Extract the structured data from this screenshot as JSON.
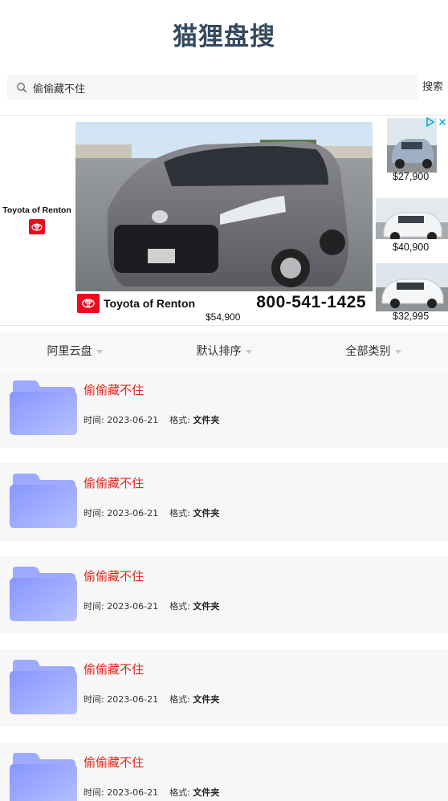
{
  "header": {
    "title": "猫狸盘搜"
  },
  "search": {
    "value": "偷偷藏不住",
    "button_label": "搜索"
  },
  "ad": {
    "brand_name": "Toyota of Renton",
    "banner_name": "Toyota of Renton",
    "banner_phone": "800-541-1425",
    "main_price": "$54,900",
    "thumb_prices": [
      "$27,900",
      "$40,900",
      "$32,995"
    ],
    "colors": {
      "toyota_red": "#eb0a1e",
      "adchoices_blue": "#00aecd"
    }
  },
  "filters": [
    {
      "label": "阿里云盘"
    },
    {
      "label": "默认排序"
    },
    {
      "label": "全部类别"
    }
  ],
  "results": [
    {
      "title": "偷偷藏不住",
      "time_label": "时间: ",
      "time": "2023-06-21",
      "format_label": "格式: ",
      "format": "文件夹"
    },
    {
      "title": "偷偷藏不住",
      "time_label": "时间: ",
      "time": "2023-06-21",
      "format_label": "格式: ",
      "format": "文件夹"
    },
    {
      "title": "偷偷藏不住",
      "time_label": "时间: ",
      "time": "2023-06-21",
      "format_label": "格式: ",
      "format": "文件夹"
    },
    {
      "title": "偷偷藏不住",
      "time_label": "时间: ",
      "time": "2023-06-21",
      "format_label": "格式: ",
      "format": "文件夹"
    },
    {
      "title": "偷偷藏不住",
      "time_label": "时间: ",
      "time": "2023-06-21",
      "format_label": "格式: ",
      "format": "文件夹"
    }
  ],
  "colors": {
    "title": "#34495e",
    "result_title": "#e1251b",
    "card_bg": "#f7f7f7",
    "folder": "#8c9cff"
  }
}
